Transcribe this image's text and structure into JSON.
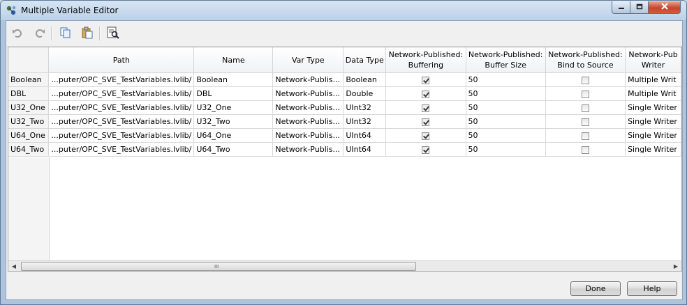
{
  "window": {
    "title": "Multiple Variable Editor"
  },
  "toolbar": {
    "buttons": [
      {
        "icon": "undo-icon"
      },
      {
        "icon": "redo-icon"
      },
      {
        "icon": "copy-icon"
      },
      {
        "icon": "paste-icon"
      },
      {
        "icon": "find-icon"
      }
    ]
  },
  "grid": {
    "columns": [
      {
        "label": ""
      },
      {
        "label": "Path"
      },
      {
        "label": "Name"
      },
      {
        "label": "Var Type"
      },
      {
        "label": "Data Type"
      },
      {
        "label": "Network-Published:\nBuffering"
      },
      {
        "label": "Network-Published:\nBuffer Size"
      },
      {
        "label": "Network-Published:\nBind to Source"
      },
      {
        "label": "Network-Pub\nWriter"
      }
    ],
    "rows": [
      {
        "row_header": "Boolean",
        "path": "...puter/OPC_SVE_TestVariables.lvlib/",
        "name": "Boolean",
        "var_type": "Network-Publis...",
        "data_type": "Boolean",
        "buffering": true,
        "buffer_size": "50",
        "bind_to_source": false,
        "writer": "Multiple Writ"
      },
      {
        "row_header": "DBL",
        "path": "...puter/OPC_SVE_TestVariables.lvlib/",
        "name": "DBL",
        "var_type": "Network-Publis...",
        "data_type": "Double",
        "buffering": true,
        "buffer_size": "50",
        "bind_to_source": false,
        "writer": "Multiple Writ"
      },
      {
        "row_header": "U32_One",
        "path": "...puter/OPC_SVE_TestVariables.lvlib/",
        "name": "U32_One",
        "var_type": "Network-Publis...",
        "data_type": "UInt32",
        "buffering": true,
        "buffer_size": "50",
        "bind_to_source": false,
        "writer": "Single Writer"
      },
      {
        "row_header": "U32_Two",
        "path": "...puter/OPC_SVE_TestVariables.lvlib/",
        "name": "U32_Two",
        "var_type": "Network-Publis...",
        "data_type": "UInt32",
        "buffering": true,
        "buffer_size": "50",
        "bind_to_source": false,
        "writer": "Single Writer"
      },
      {
        "row_header": "U64_One",
        "path": "...puter/OPC_SVE_TestVariables.lvlib/",
        "name": "U64_One",
        "var_type": "Network-Publis...",
        "data_type": "UInt64",
        "buffering": true,
        "buffer_size": "50",
        "bind_to_source": false,
        "writer": "Single Writer"
      },
      {
        "row_header": "U64_Two",
        "path": "...puter/OPC_SVE_TestVariables.lvlib/",
        "name": "U64_Two",
        "var_type": "Network-Publis...",
        "data_type": "UInt64",
        "buffering": true,
        "buffer_size": "50",
        "bind_to_source": false,
        "writer": "Single Writer"
      }
    ]
  },
  "scrollbar": {
    "grip": "III"
  },
  "buttons": {
    "done": "Done",
    "help": "Help"
  }
}
